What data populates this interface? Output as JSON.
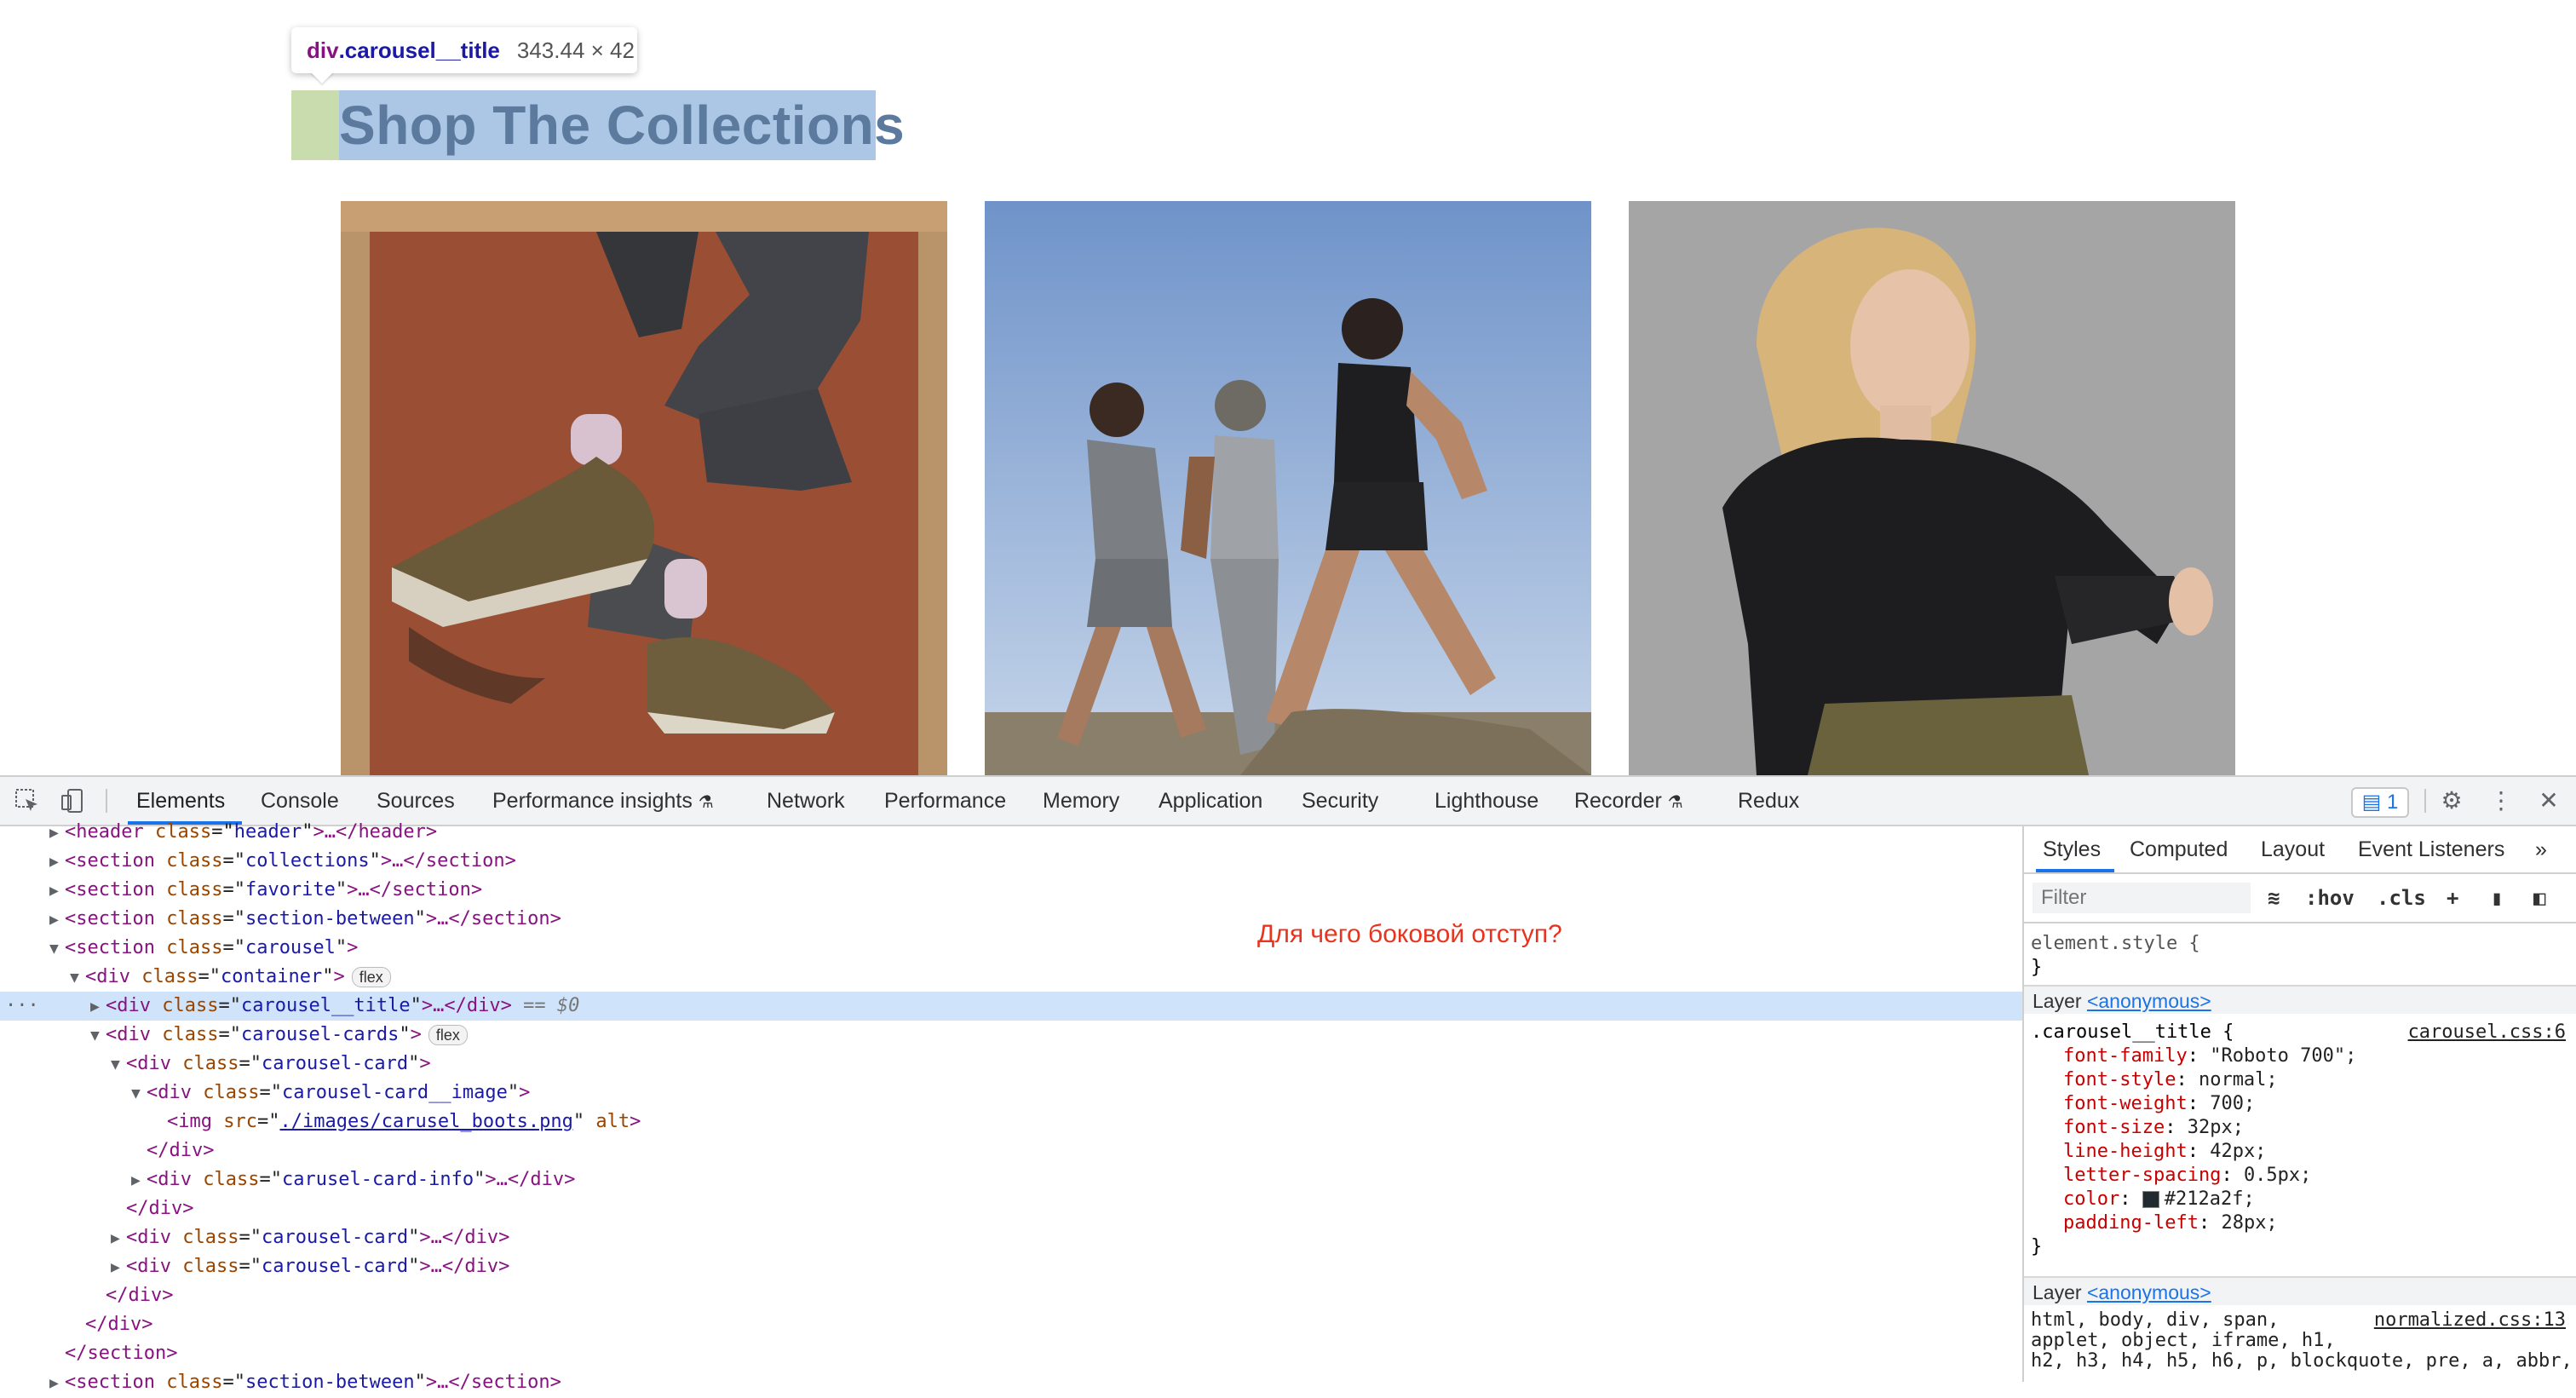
{
  "page": {
    "tooltip": {
      "tag": "div",
      "class": ".carousel__title",
      "dims": "343.44 × 42"
    },
    "title": "Shop The Collections",
    "cards": [
      {
        "image": "boots-on-orange-background"
      },
      {
        "image": "runners-on-hillside"
      },
      {
        "image": "woman-in-black-long-sleeve"
      }
    ]
  },
  "devtools": {
    "tabs": [
      "Elements",
      "Console",
      "Sources",
      "Performance insights",
      "Network",
      "Performance",
      "Memory",
      "Application",
      "Security",
      "Lighthouse",
      "Recorder",
      "Redux"
    ],
    "issues_count": "1",
    "annotation": "Для чего боковой отступ?",
    "tree": {
      "r0": {
        "tag": "header",
        "attr": "class",
        "val": "header",
        "rest": "…</header>"
      },
      "r1": {
        "tag": "section",
        "attr": "class",
        "val": "collections",
        "rest": "…</section>"
      },
      "r2": {
        "tag": "section",
        "attr": "class",
        "val": "favorite",
        "rest": "…</section>"
      },
      "r3": {
        "tag": "section",
        "attr": "class",
        "val": "section-between",
        "rest": "…</section>"
      },
      "r4": {
        "tag": "section",
        "attr": "class",
        "val": "carousel"
      },
      "r5": {
        "tag": "div",
        "attr": "class",
        "val": "container",
        "badge": "flex"
      },
      "r6": {
        "tag": "div",
        "attr": "class",
        "val": "carousel__title",
        "rest": "…</div>",
        "eq": "== $0"
      },
      "r7": {
        "tag": "div",
        "attr": "class",
        "val": "carousel-cards",
        "badge": "flex"
      },
      "r8": {
        "tag": "div",
        "attr": "class",
        "val": "carousel-card"
      },
      "r9": {
        "tag": "div",
        "attr": "class",
        "val": "carousel-card__image"
      },
      "r10": {
        "tag": "img",
        "attr": "src",
        "val": "./images/carusel_boots.png",
        "attr2": "alt"
      },
      "r11": {
        "close": "</div>"
      },
      "r12": {
        "tag": "div",
        "attr": "class",
        "val": "carusel-card-info",
        "rest": "…</div>"
      },
      "r13": {
        "close": "</div>"
      },
      "r14": {
        "tag": "div",
        "attr": "class",
        "val": "carousel-card",
        "rest": "…</div>"
      },
      "r15": {
        "tag": "div",
        "attr": "class",
        "val": "carousel-card",
        "rest": "…</div>"
      },
      "r16": {
        "close": "</div>"
      },
      "r17": {
        "close": "</div>"
      },
      "r18": {
        "close": "</section>"
      },
      "r19": {
        "tag": "section",
        "attr": "class",
        "val": "section-between",
        "rest": "…</section>"
      }
    },
    "styles": {
      "subtabs": [
        "Styles",
        "Computed",
        "Layout",
        "Event Listeners",
        "»"
      ],
      "filter_placeholder": "Filter",
      "tools": [
        ":hov",
        ".cls",
        "+"
      ],
      "element_style": "element.style {",
      "close_brace": "}",
      "layer_label": "Layer",
      "layer_link": "<anonymous>",
      "rule_selector": ".carousel__title {",
      "rule_source": "carousel.css:6",
      "props": [
        {
          "name": "font-family",
          "value": "\"Roboto 700\";"
        },
        {
          "name": "font-style",
          "value": "normal;"
        },
        {
          "name": "font-weight",
          "value": "700;"
        },
        {
          "name": "font-size",
          "value": "32px;"
        },
        {
          "name": "line-height",
          "value": "42px;"
        },
        {
          "name": "letter-spacing",
          "value": "0.5px;"
        },
        {
          "name": "color",
          "value": "#212a2f;"
        },
        {
          "name": "padding-left",
          "value": "28px;"
        }
      ],
      "normalize_source": "normalized.css:13",
      "normalize_lines": [
        "html, body, div, span,",
        "applet, object, iframe, h1,",
        "h2, h3, h4, h5, h6, p, blockquote, pre, a, abbr,"
      ]
    }
  }
}
